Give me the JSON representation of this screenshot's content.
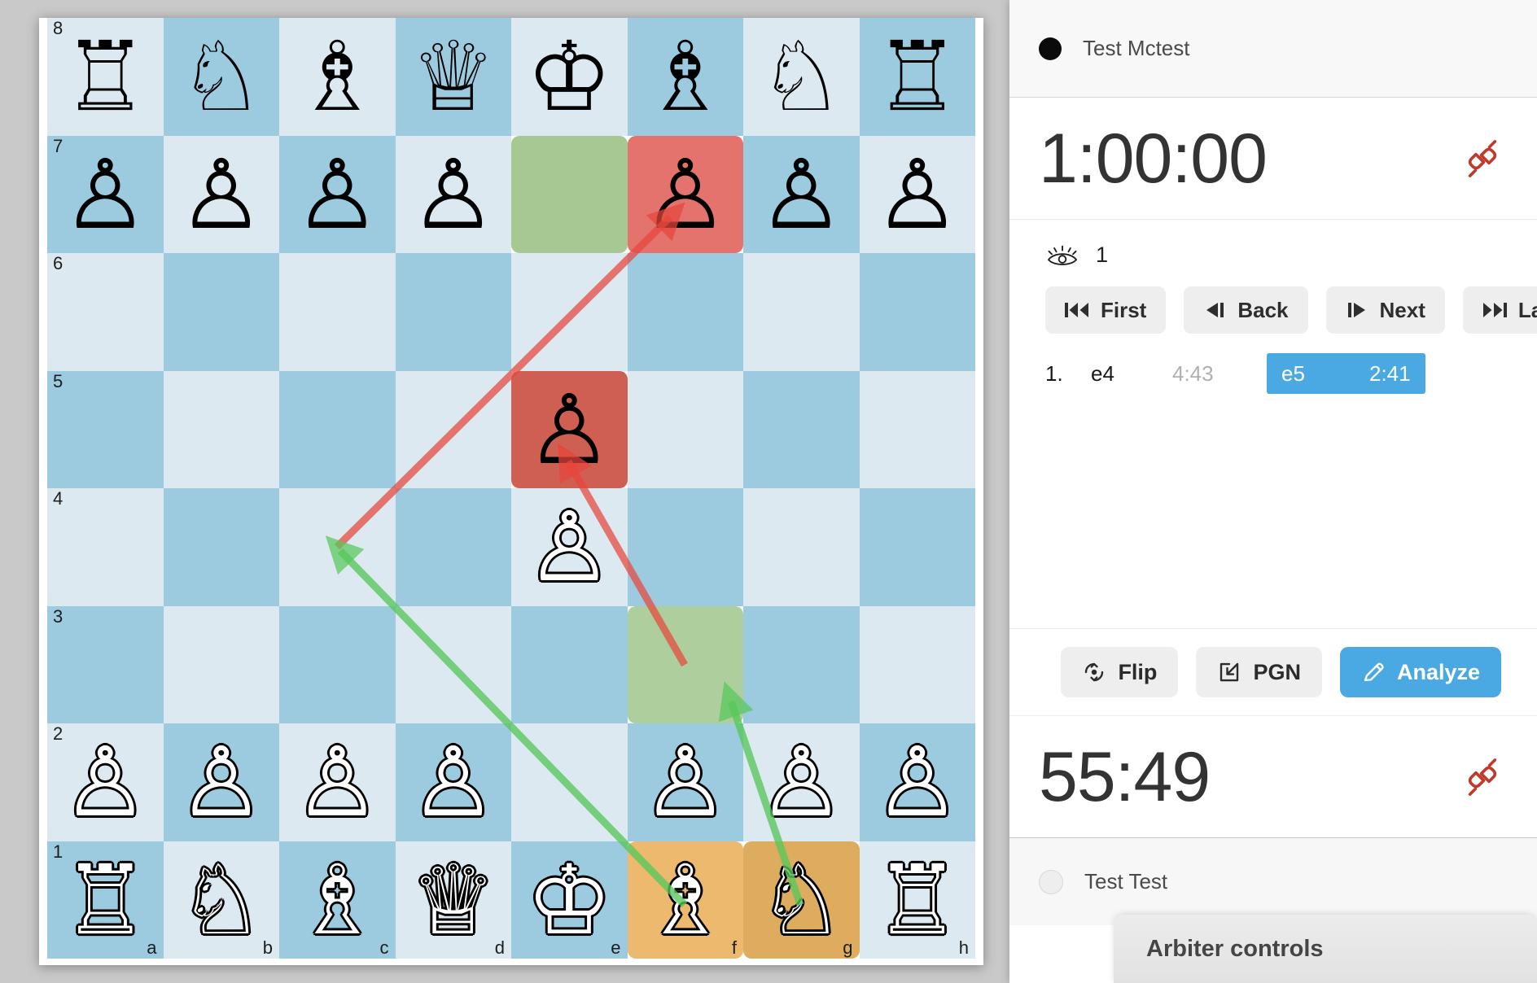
{
  "board": {
    "orientation": "white",
    "files": [
      "a",
      "b",
      "c",
      "d",
      "e",
      "f",
      "g",
      "h"
    ],
    "ranks": [
      "8",
      "7",
      "6",
      "5",
      "4",
      "3",
      "2",
      "1"
    ],
    "position": [
      [
        "r",
        "n",
        "b",
        "q",
        "k",
        "b",
        "n",
        "r"
      ],
      [
        "p",
        "p",
        "p",
        "p",
        "",
        "p",
        "p",
        "p"
      ],
      [
        "",
        "",
        "",
        "",
        "",
        "",
        "",
        ""
      ],
      [
        "",
        "",
        "",
        "",
        "p",
        "",
        "",
        ""
      ],
      [
        "",
        "",
        "",
        "",
        "P",
        "",
        "",
        ""
      ],
      [
        "",
        "",
        "",
        "",
        "",
        "",
        "",
        ""
      ],
      [
        "P",
        "P",
        "P",
        "P",
        "",
        "P",
        "P",
        "P"
      ],
      [
        "R",
        "N",
        "B",
        "Q",
        "K",
        "B",
        "N",
        "R"
      ]
    ],
    "highlights": [
      {
        "square": "e7",
        "color": "green"
      },
      {
        "square": "f7",
        "color": "red"
      },
      {
        "square": "e5",
        "color": "red"
      },
      {
        "square": "f3",
        "color": "green"
      },
      {
        "square": "f1",
        "color": "orange"
      },
      {
        "square": "g1",
        "color": "orange"
      }
    ],
    "arrows": [
      {
        "from": "c4",
        "to": "f7",
        "color": "red"
      },
      {
        "from": "f3",
        "to": "e5",
        "color": "red"
      },
      {
        "from": "f1",
        "to": "c4",
        "color": "green"
      },
      {
        "from": "g1",
        "to": "f3",
        "color": "green"
      }
    ],
    "colors": {
      "light": "#dce9f0",
      "dark": "#9ccbe0",
      "highlight_green": "#aecf9d",
      "highlight_red": "#e3736c",
      "highlight_orange": "#ecb96e",
      "arrow_red": "#e8453c",
      "arrow_green": "#57c75a"
    }
  },
  "panel": {
    "top_player": {
      "name": "Test Mctest",
      "color": "black"
    },
    "bottom_player": {
      "name": "Test Test",
      "color": "white"
    },
    "top_clock": "1:00:00",
    "bottom_clock": "55:49",
    "top_connection_icon": "disconnected-plug-icon",
    "bottom_connection_icon": "disconnected-plug-icon",
    "connection_color": "#c0392b",
    "spectators": {
      "icon": "eye-icon",
      "count": "1"
    },
    "nav_buttons": [
      {
        "label": "First",
        "icon": "skip-back-icon"
      },
      {
        "label": "Back",
        "icon": "step-back-icon"
      },
      {
        "label": "Next",
        "icon": "step-forward-icon"
      },
      {
        "label": "Last",
        "icon": "skip-forward-icon"
      }
    ],
    "moves": [
      {
        "number": "1.",
        "white": {
          "san": "e4",
          "clock": "4:43",
          "selected": false
        },
        "black": {
          "san": "e5",
          "clock": "2:41",
          "selected": true
        }
      }
    ],
    "toolbar": [
      {
        "label": "Flip",
        "icon": "rotate-icon",
        "primary": false
      },
      {
        "label": "PGN",
        "icon": "export-icon",
        "primary": false
      },
      {
        "label": "Analyze",
        "icon": "pencil-icon",
        "primary": true
      }
    ],
    "accent_color": "#4aa9e2"
  },
  "arbiter": {
    "title": "Arbiter controls"
  }
}
